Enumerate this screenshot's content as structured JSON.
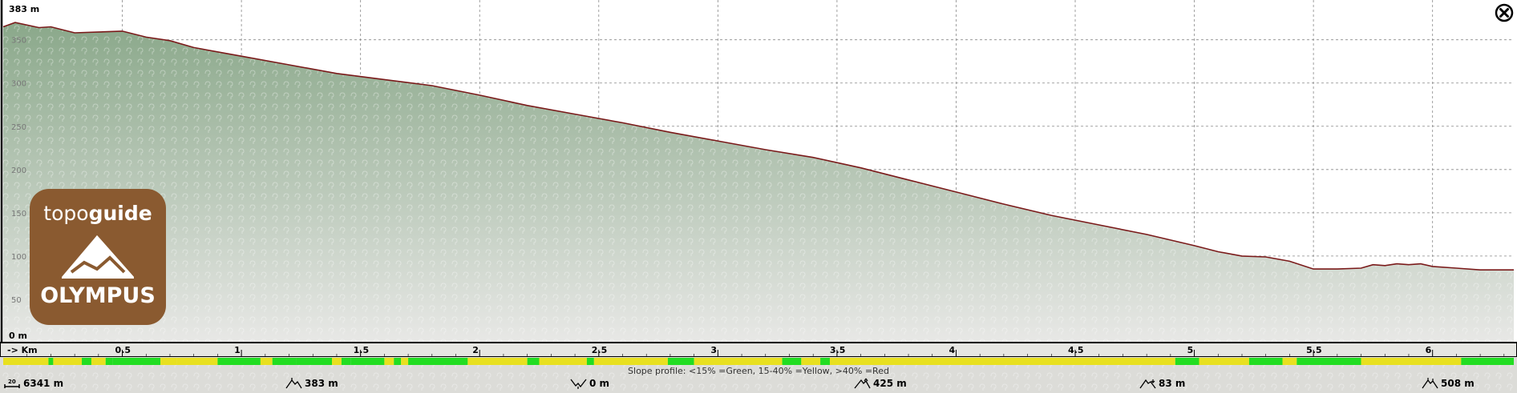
{
  "chart_data": {
    "type": "area",
    "title": "",
    "xlabel": "Km",
    "ylabel": "m",
    "x_axis_label": "-> Km",
    "y_max_label": "383 m",
    "y_min_label": "0 m",
    "ylim": [
      0,
      383
    ],
    "xlim": [
      0,
      6.341
    ],
    "y_ticks": [
      50,
      100,
      150,
      200,
      250,
      300,
      350
    ],
    "x_ticks": [
      "0.5",
      "1",
      "1.5",
      "2",
      "2.5",
      "3",
      "3.5",
      "4",
      "4.5",
      "5",
      "5.5",
      "6"
    ],
    "x_tick_values": [
      0.5,
      1,
      1.5,
      2,
      2.5,
      3,
      3.5,
      4,
      4.5,
      5,
      5.5,
      6
    ],
    "grid": true,
    "series": [
      {
        "x": [
          0,
          0.05,
          0.15,
          0.2,
          0.3,
          0.5,
          0.6,
          0.7,
          0.8,
          1.0,
          1.2,
          1.4,
          1.6,
          1.8,
          2.0,
          2.2,
          2.4,
          2.6,
          2.8,
          3.0,
          3.2,
          3.4,
          3.6,
          3.8,
          4.0,
          4.2,
          4.4,
          4.6,
          4.8,
          5.0,
          5.1,
          5.2,
          5.3,
          5.4,
          5.5,
          5.6,
          5.7,
          5.75,
          5.8,
          5.85,
          5.9,
          5.95,
          6.0,
          6.1,
          6.2,
          6.341
        ],
        "y": [
          365,
          370,
          364,
          365,
          358,
          360,
          353,
          349,
          341,
          331,
          321,
          311,
          304,
          297,
          286,
          274,
          264,
          254,
          243,
          233,
          223,
          214,
          202,
          188,
          174,
          160,
          147,
          136,
          125,
          112,
          105,
          100,
          99,
          94,
          85,
          85,
          86,
          90,
          89,
          91,
          90,
          91,
          88,
          86,
          84,
          84
        ]
      }
    ],
    "slope_profile": {
      "segments": [
        {
          "from": 0.0,
          "to": 0.19,
          "class": "yellow"
        },
        {
          "from": 0.19,
          "to": 0.21,
          "class": "green"
        },
        {
          "from": 0.21,
          "to": 0.33,
          "class": "yellow"
        },
        {
          "from": 0.33,
          "to": 0.37,
          "class": "green"
        },
        {
          "from": 0.37,
          "to": 0.43,
          "class": "yellow"
        },
        {
          "from": 0.43,
          "to": 0.46,
          "class": "green"
        },
        {
          "from": 0.46,
          "to": 0.66,
          "class": "green"
        },
        {
          "from": 0.66,
          "to": 0.73,
          "class": "yellow"
        },
        {
          "from": 0.73,
          "to": 0.9,
          "class": "yellow"
        },
        {
          "from": 0.9,
          "to": 1.08,
          "class": "green"
        },
        {
          "from": 1.08,
          "to": 1.13,
          "class": "yellow"
        },
        {
          "from": 1.13,
          "to": 1.23,
          "class": "green"
        },
        {
          "from": 1.23,
          "to": 1.38,
          "class": "green"
        },
        {
          "from": 1.38,
          "to": 1.42,
          "class": "yellow"
        },
        {
          "from": 1.42,
          "to": 1.46,
          "class": "green"
        },
        {
          "from": 1.46,
          "to": 1.6,
          "class": "green"
        },
        {
          "from": 1.6,
          "to": 1.64,
          "class": "yellow"
        },
        {
          "from": 1.64,
          "to": 1.67,
          "class": "green"
        },
        {
          "from": 1.67,
          "to": 1.7,
          "class": "yellow"
        },
        {
          "from": 1.7,
          "to": 1.95,
          "class": "green"
        },
        {
          "from": 1.95,
          "to": 2.2,
          "class": "yellow"
        },
        {
          "from": 2.2,
          "to": 2.25,
          "class": "green"
        },
        {
          "from": 2.25,
          "to": 2.45,
          "class": "yellow"
        },
        {
          "from": 2.45,
          "to": 2.48,
          "class": "green"
        },
        {
          "from": 2.48,
          "to": 2.79,
          "class": "yellow"
        },
        {
          "from": 2.79,
          "to": 2.9,
          "class": "green"
        },
        {
          "from": 2.9,
          "to": 3.27,
          "class": "yellow"
        },
        {
          "from": 3.27,
          "to": 3.35,
          "class": "green"
        },
        {
          "from": 3.35,
          "to": 3.43,
          "class": "yellow"
        },
        {
          "from": 3.43,
          "to": 3.47,
          "class": "green"
        },
        {
          "from": 3.47,
          "to": 4.92,
          "class": "yellow"
        },
        {
          "from": 4.92,
          "to": 5.02,
          "class": "green"
        },
        {
          "from": 5.02,
          "to": 5.23,
          "class": "yellow"
        },
        {
          "from": 5.23,
          "to": 5.37,
          "class": "green"
        },
        {
          "from": 5.37,
          "to": 5.43,
          "class": "yellow"
        },
        {
          "from": 5.43,
          "to": 5.7,
          "class": "green"
        },
        {
          "from": 5.7,
          "to": 6.12,
          "class": "yellow"
        },
        {
          "from": 6.12,
          "to": 6.341,
          "class": "green"
        }
      ],
      "legend": "Slope profile: <15% =Green, 15-40% =Yellow, >40% =Red"
    }
  },
  "colors": {
    "fill_top": "#8aa88a",
    "fill_bottom": "#e8e8e6",
    "profile_line": "#7a1a1a",
    "grid": "#888888",
    "slope_green": "#22dd22",
    "slope_yellow": "#e8e020",
    "slope_red": "#dd2222",
    "logo_bg": "#8a5a30"
  },
  "logo": {
    "line1_light": "topo",
    "line1_bold": "guide",
    "line2": "OLYMPUS"
  },
  "stats": {
    "distance": "6341 m",
    "max_elevation": "383 m",
    "min_elevation": "0 m",
    "ascent": "425 m",
    "descent": "83 m",
    "total": "508 m"
  },
  "icons": {
    "close": "close-circle-icon",
    "distance": "distance-icon",
    "max_elevation": "peak-icon",
    "min_elevation": "valley-icon",
    "ascent": "ascent-icon",
    "descent": "descent-icon",
    "total": "total-elevation-icon"
  }
}
